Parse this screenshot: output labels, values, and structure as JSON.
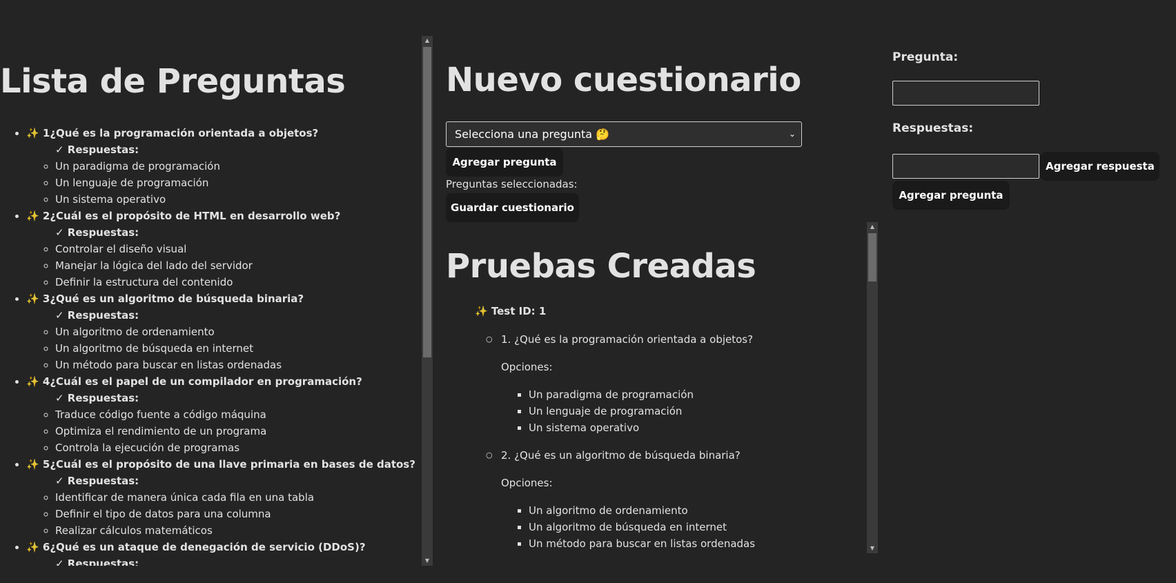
{
  "left": {
    "title": "Lista de Preguntas",
    "answers_label": "✓ Respuestas:",
    "questions": [
      {
        "label": "✨ 1¿Qué es la programación orientada a objetos?",
        "answers": [
          "Un paradigma de programación",
          "Un lenguaje de programación",
          "Un sistema operativo"
        ]
      },
      {
        "label": "✨ 2¿Cuál es el propósito de HTML en desarrollo web?",
        "answers": [
          "Controlar el diseño visual",
          "Manejar la lógica del lado del servidor",
          "Definir la estructura del contenido"
        ]
      },
      {
        "label": "✨ 3¿Qué es un algoritmo de búsqueda binaria?",
        "answers": [
          "Un algoritmo de ordenamiento",
          "Un algoritmo de búsqueda en internet",
          "Un método para buscar en listas ordenadas"
        ]
      },
      {
        "label": "✨ 4¿Cuál es el papel de un compilador en programación?",
        "answers": [
          "Traduce código fuente a código máquina",
          "Optimiza el rendimiento de un programa",
          "Controla la ejecución de programas"
        ]
      },
      {
        "label": "✨ 5¿Cuál es el propósito de una llave primaria en bases de datos?",
        "answers": [
          "Identificar de manera única cada fila en una tabla",
          "Definir el tipo de datos para una columna",
          "Realizar cálculos matemáticos"
        ]
      },
      {
        "label": "✨ 6¿Qué es un ataque de denegación de servicio (DDoS)?",
        "answers": []
      }
    ]
  },
  "middle": {
    "title": "Nuevo cuestionario",
    "select_value": "Selecciona una pregunta 🤔",
    "add_question_btn": "Agregar pregunta",
    "selected_label": "Preguntas seleccionadas:",
    "save_btn": "Guardar cuestionario"
  },
  "tests": {
    "title": "Pruebas Creadas",
    "test_head": "✨ Test ID: 1",
    "options_label": "Opciones:",
    "questions": [
      {
        "text": "1. ¿Qué es la programación orientada a objetos?",
        "options": [
          "Un paradigma de programación",
          "Un lenguaje de programación",
          "Un sistema operativo"
        ]
      },
      {
        "text": "2. ¿Qué es un algoritmo de búsqueda binaria?",
        "options": [
          "Un algoritmo de ordenamiento",
          "Un algoritmo de búsqueda en internet",
          "Un método para buscar en listas ordenadas"
        ]
      }
    ]
  },
  "right": {
    "question_label": "Pregunta:",
    "answers_label": "Respuestas:",
    "add_answer_btn": "Agregar respuesta",
    "add_question_btn": "Agregar pregunta",
    "question_value": "",
    "answer_value": ""
  }
}
